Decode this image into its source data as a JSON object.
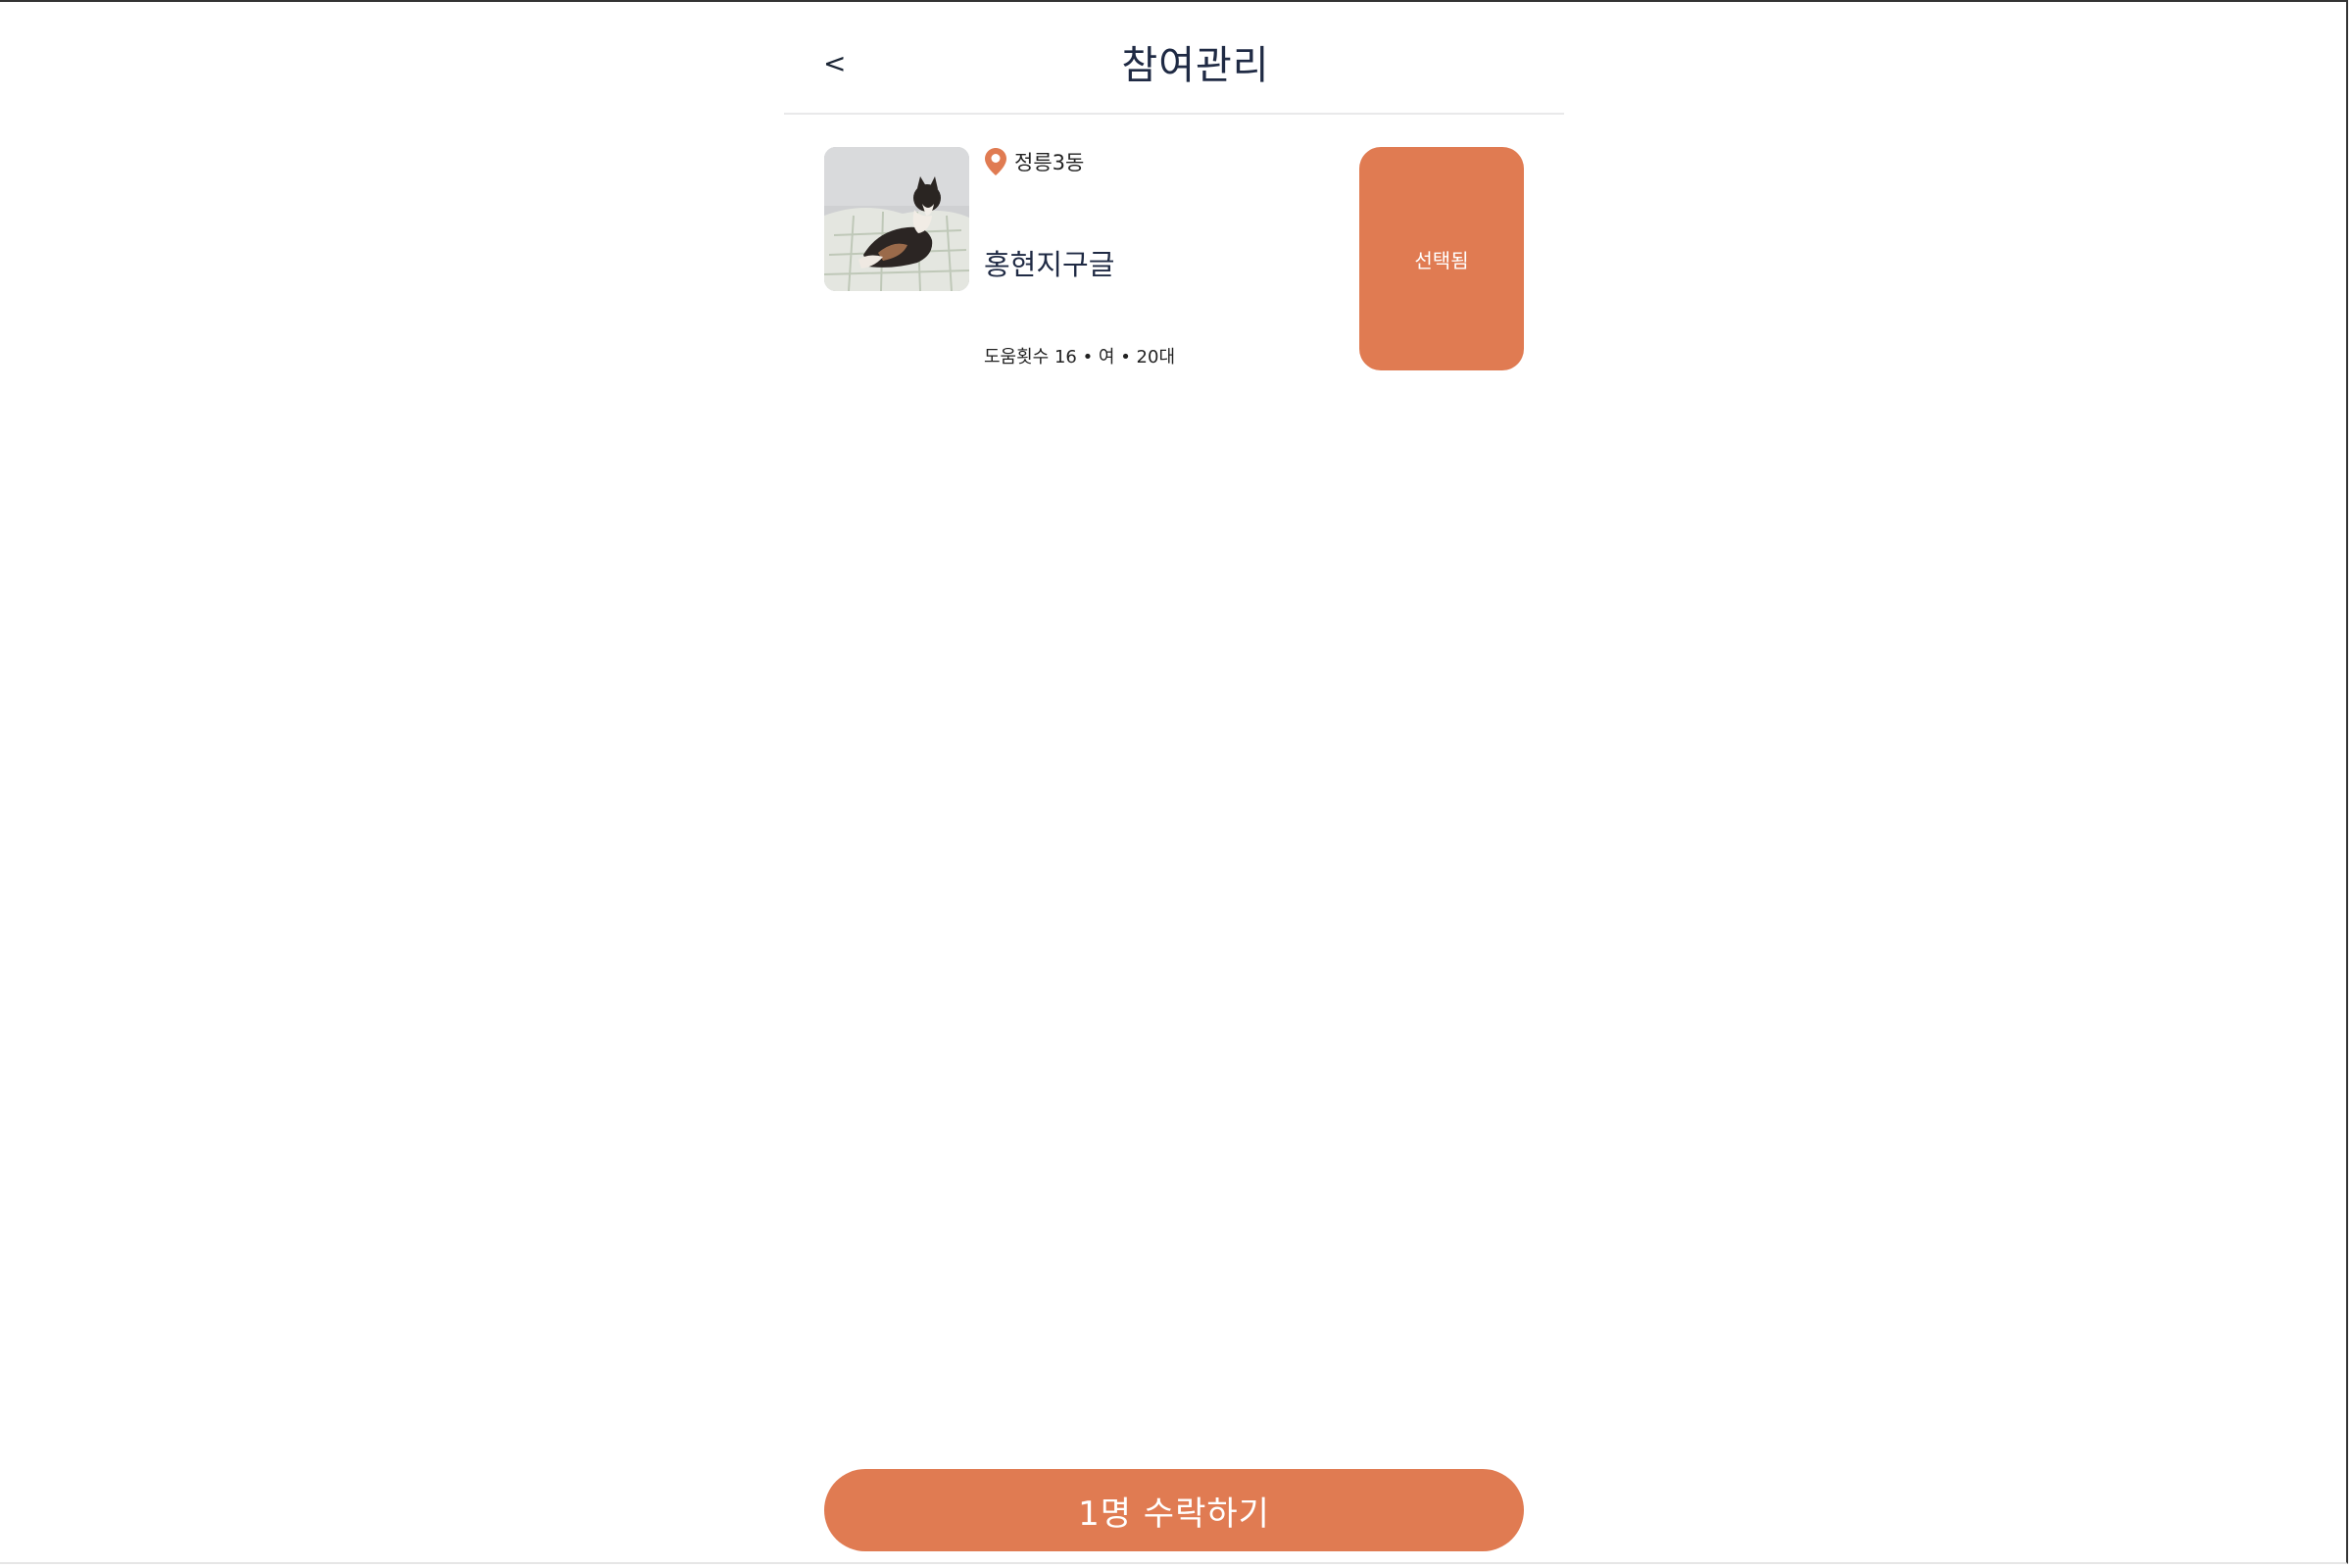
{
  "header": {
    "back_label": "<",
    "title": "참여관리"
  },
  "participants": [
    {
      "photo_icon": "cat-photo",
      "location": "정릉3동",
      "name": "홍현지구글",
      "meta": "도움횟수 16 • 여 • 20대",
      "select_label": "선택됨"
    }
  ],
  "footer": {
    "accept_label": "1명 수락하기"
  },
  "colors": {
    "accent": "#e07b52",
    "title_text": "#1f2a44",
    "divider": "#e9e9ea"
  }
}
